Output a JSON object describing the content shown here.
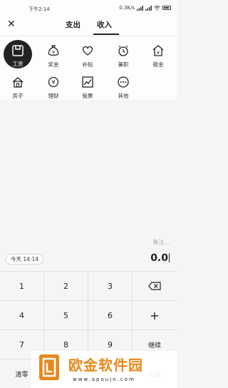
{
  "status_bar": {
    "time": "下午2:14",
    "network_speed": "0.3K/s"
  },
  "header": {
    "close_icon": "close-icon",
    "tabs": [
      {
        "label": "支出"
      },
      {
        "label": "收入",
        "active": true
      }
    ]
  },
  "categories": [
    {
      "label": "工资",
      "icon": "salary-icon",
      "active": true
    },
    {
      "label": "奖金",
      "icon": "money-bag-icon"
    },
    {
      "label": "补贴",
      "icon": "heart-icon"
    },
    {
      "label": "兼职",
      "icon": "clock-icon"
    },
    {
      "label": "租金",
      "icon": "house-price-icon"
    },
    {
      "label": "房子",
      "icon": "house-icon"
    },
    {
      "label": "理财",
      "icon": "yen-coin-icon"
    },
    {
      "label": "股票",
      "icon": "trend-chart-icon"
    },
    {
      "label": "其他",
      "icon": "more-icon"
    }
  ],
  "entry": {
    "note_placeholder": "备注...",
    "amount": "0.0",
    "date_label": "今天 14:14"
  },
  "keypad": {
    "rows": [
      [
        "1",
        "2",
        "3",
        ""
      ],
      [
        "4",
        "5",
        "6",
        "+"
      ],
      [
        "7",
        "8",
        "9",
        "继续"
      ],
      [
        "清零",
        "0",
        ".",
        "完成"
      ]
    ],
    "backspace_icon": "backspace-icon"
  },
  "watermark": {
    "title": "欧金软件园",
    "url": "www.apoujn.com"
  },
  "colors": {
    "active_bg": "#222222",
    "watermark_orange": "#e8891c",
    "background": "#f5f5f5"
  }
}
